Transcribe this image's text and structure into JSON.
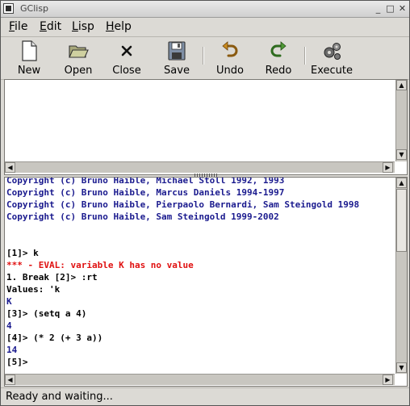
{
  "window": {
    "title": "GClisp"
  },
  "menu": [
    {
      "label": "File",
      "mnemonic": "F",
      "rest": "ile"
    },
    {
      "label": "Edit",
      "mnemonic": "E",
      "rest": "dit"
    },
    {
      "label": "Lisp",
      "mnemonic": "L",
      "rest": "isp"
    },
    {
      "label": "Help",
      "mnemonic": "H",
      "rest": "elp"
    }
  ],
  "toolbar": {
    "new": "New",
    "open": "Open",
    "close": "Close",
    "save": "Save",
    "undo": "Undo",
    "redo": "Redo",
    "execute": "Execute"
  },
  "console": {
    "lines": [
      {
        "text": "Copyright (c) Bruno Haible, Michael Stoll 1992, 1993",
        "color": "#1a1a8e"
      },
      {
        "text": "Copyright (c) Bruno Haible, Marcus Daniels 1994-1997",
        "color": "#1a1a8e"
      },
      {
        "text": "Copyright (c) Bruno Haible, Pierpaolo Bernardi, Sam Steingold 1998",
        "color": "#1a1a8e"
      },
      {
        "text": "Copyright (c) Bruno Haible, Sam Steingold 1999-2002",
        "color": "#1a1a8e"
      },
      {
        "text": "",
        "color": "#000000"
      },
      {
        "text": "",
        "color": "#000000"
      },
      {
        "text": "[1]> k",
        "color": "#000000"
      },
      {
        "text": "*** - EVAL: variable K has no value",
        "color": "#e01010"
      },
      {
        "text": "1. Break [2]> :rt",
        "color": "#000000"
      },
      {
        "text": "Values: 'k",
        "color": "#000000"
      },
      {
        "text": "K",
        "color": "#1a1a8e"
      },
      {
        "text": "[3]> (setq a 4)",
        "color": "#000000"
      },
      {
        "text": "4",
        "color": "#1a1a8e"
      },
      {
        "text": "[4]> (* 2 (+ 3 a))",
        "color": "#000000"
      },
      {
        "text": "14",
        "color": "#1a1a8e"
      },
      {
        "text": "[5]>",
        "color": "#000000"
      }
    ]
  },
  "status": {
    "text": "Ready and waiting..."
  }
}
